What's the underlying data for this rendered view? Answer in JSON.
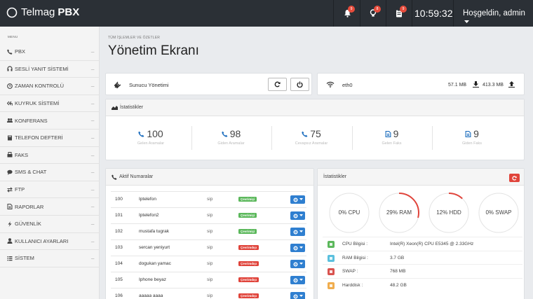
{
  "topbar": {
    "brand_name": "Telmag",
    "brand_bold": "PBX",
    "notifications": [
      {
        "icon": "bell-icon",
        "count": "9"
      },
      {
        "icon": "lightbulb-icon",
        "count": "8"
      },
      {
        "icon": "clipboard-icon",
        "count": "9"
      }
    ],
    "clock": "10:59:32",
    "user": "Hoşgeldin, admin"
  },
  "sidebar": {
    "menu_title": "MENU",
    "items": [
      {
        "label": "PBX",
        "icon": "phone-icon"
      },
      {
        "label": "SESLİ YANIT SİSTEMİ",
        "icon": "headset-icon"
      },
      {
        "label": "ZAMAN KONTROLÜ",
        "icon": "clock-icon"
      },
      {
        "label": "KUYRUK SİSTEMİ",
        "icon": "reply-all-icon"
      },
      {
        "label": "KONFERANS",
        "icon": "users-icon"
      },
      {
        "label": "TELEFON DEFTERİ",
        "icon": "book-icon"
      },
      {
        "label": "FAKS",
        "icon": "fax-icon"
      },
      {
        "label": "SMS & CHAT",
        "icon": "chat-icon"
      },
      {
        "label": "FTP",
        "icon": "exchange-icon"
      },
      {
        "label": "RAPORLAR",
        "icon": "file-icon"
      },
      {
        "label": "GÜVENLİK",
        "icon": "bolt-icon"
      },
      {
        "label": "KULLANICI AYARLARI",
        "icon": "user-icon"
      },
      {
        "label": "SİSTEM",
        "icon": "list-icon"
      }
    ],
    "dots": "....."
  },
  "page": {
    "breadcrumb": "TÜM İŞLEMLER VE ÖZETLER",
    "title": "Yönetim Ekranı"
  },
  "server": {
    "title": "Sunucu Yönetimi",
    "iface": "eth0",
    "download": "57.1 MB",
    "upload": "413.3 MB"
  },
  "stats_panel": {
    "title": "İstatistikler",
    "items": [
      {
        "value": "100",
        "label": "Gelen Aramalar",
        "icon": "phone-icon",
        "color": "#1f6fbf"
      },
      {
        "value": "98",
        "label": "Giden Aramalar",
        "icon": "phone-icon",
        "color": "#1f6fbf"
      },
      {
        "value": "75",
        "label": "Cevapsız Aramalar",
        "icon": "phone-icon",
        "color": "#1f6fbf"
      },
      {
        "value": "9",
        "label": "Gelen Faks",
        "icon": "document-icon",
        "color": "#1f6fbf"
      },
      {
        "value": "9",
        "label": "Giden Faks",
        "icon": "document-icon",
        "color": "#1f6fbf"
      }
    ]
  },
  "numbers_panel": {
    "title": "Aktif Numaralar",
    "rows": [
      {
        "ext": "100",
        "name": "Iptelefon",
        "type": "sip",
        "status": "Çevrimiçi",
        "color": "#5cb85c"
      },
      {
        "ext": "101",
        "name": "Iptelefon2",
        "type": "sip",
        "status": "Çevrimiçi",
        "color": "#5cb85c"
      },
      {
        "ext": "102",
        "name": "mustafa tugrak",
        "type": "sip",
        "status": "Çevrimiçi",
        "color": "#5cb85c"
      },
      {
        "ext": "103",
        "name": "sercan yeniyurt",
        "type": "sip",
        "status": "Çevrimdışı",
        "color": "#e0443b"
      },
      {
        "ext": "104",
        "name": "dogukan yamac",
        "type": "sip",
        "status": "Çevrimdışı",
        "color": "#e0443b"
      },
      {
        "ext": "105",
        "name": "Iphone beyaz",
        "type": "sip",
        "status": "Çevrimdışı",
        "color": "#e0443b"
      },
      {
        "ext": "106",
        "name": "aaaaa aaaa",
        "type": "sip",
        "status": "Çevrimdışı",
        "color": "#e0443b"
      }
    ]
  },
  "system_panel": {
    "title": "İstatistikler",
    "gauges": [
      {
        "label": "0% CPU",
        "percent": 0
      },
      {
        "label": "29% RAM",
        "percent": 29
      },
      {
        "label": "12% HDD",
        "percent": 12
      },
      {
        "label": "0% SWAP",
        "percent": 0
      }
    ],
    "info": [
      {
        "key": "CPU Bilgisi :",
        "value": "Intel(R) Xeon(R) CPU E5345 @ 2.33GHz",
        "color": "#5cb85c",
        "icon": "chip-icon"
      },
      {
        "key": "RAM Bilgisi :",
        "value": "3.7 GB",
        "color": "#5bc0de",
        "icon": "memory-icon"
      },
      {
        "key": "SWAP :",
        "value": "768 MB",
        "color": "#d9534f",
        "icon": "swap-icon"
      },
      {
        "key": "Harddisk :",
        "value": "48.2 GB",
        "color": "#f0ad4e",
        "icon": "disk-icon"
      }
    ]
  }
}
